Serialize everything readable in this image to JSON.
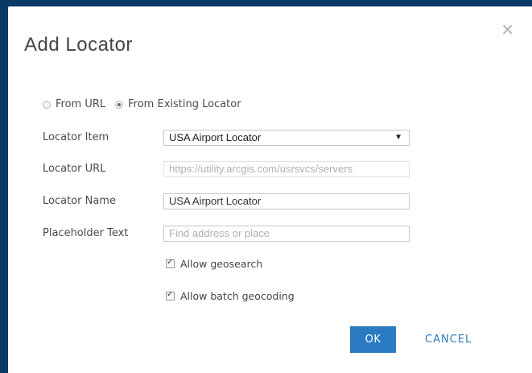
{
  "dialog": {
    "title": "Add Locator",
    "close_icon": "×"
  },
  "source": {
    "options": [
      {
        "label": "From URL",
        "selected": false
      },
      {
        "label": "From Existing Locator",
        "selected": true
      }
    ]
  },
  "form": {
    "locator_item_label": "Locator Item",
    "locator_item_value": "USA Airport Locator",
    "locator_url_label": "Locator URL",
    "locator_url_value": "https://utility.arcgis.com/usrsvcs/servers",
    "locator_name_label": "Locator Name",
    "locator_name_value": "USA Airport Locator",
    "placeholder_label": "Placeholder Text",
    "placeholder_value": "Find address or place"
  },
  "options": {
    "geosearch_label": "Allow geosearch",
    "geosearch_checked": true,
    "batch_label": "Allow batch geocoding",
    "batch_checked": true
  },
  "buttons": {
    "ok": "OK",
    "cancel": "CANCEL"
  },
  "colors": {
    "backdrop": "#0b3a66",
    "accent": "#2a7ac2"
  }
}
